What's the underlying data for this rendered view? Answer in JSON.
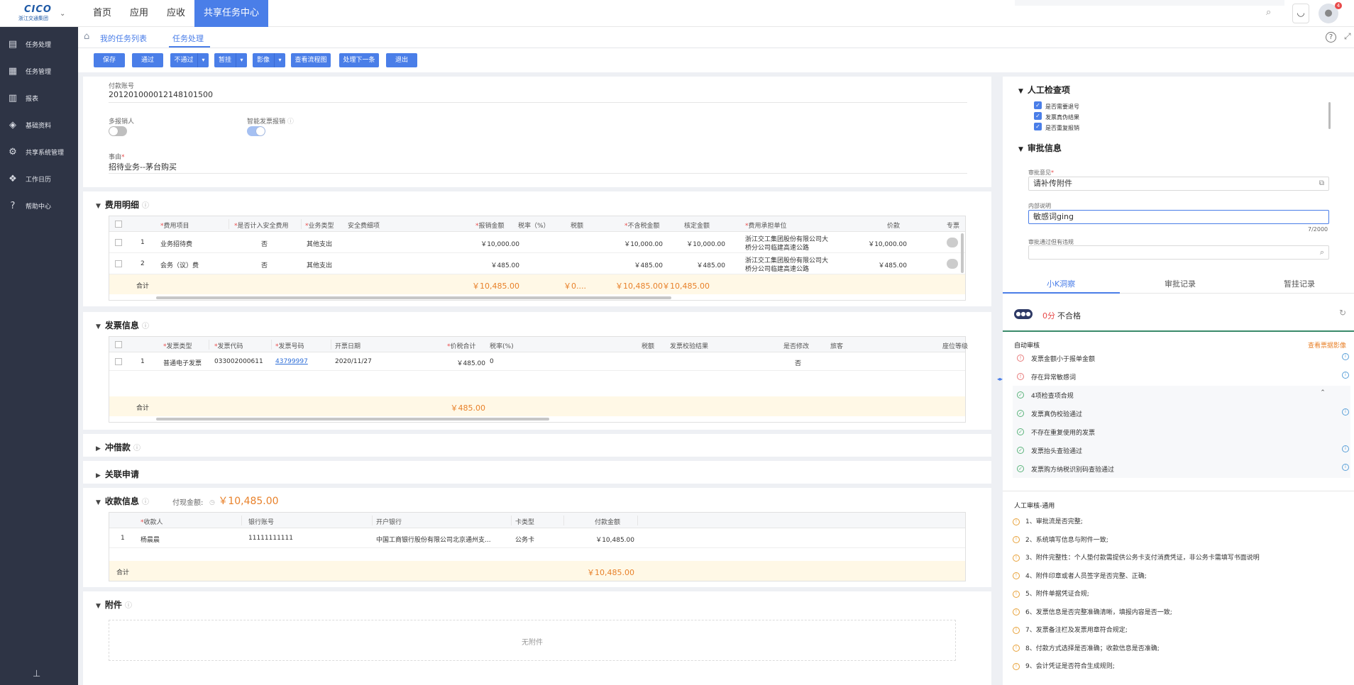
{
  "header": {
    "logo_main": "CICO",
    "logo_sub": "浙江交通集团",
    "nav": [
      "首页",
      "应用",
      "应收",
      "共享任务中心"
    ]
  },
  "sidebar": {
    "items": [
      {
        "label": "任务处理",
        "icon": "task-icon"
      },
      {
        "label": "任务管理",
        "icon": "task-manage-icon"
      },
      {
        "label": "报表",
        "icon": "report-icon"
      },
      {
        "label": "基础资料",
        "icon": "layers-icon"
      },
      {
        "label": "共享系统管理",
        "icon": "settings-icon"
      },
      {
        "label": "工作日历",
        "icon": "calendar-icon"
      },
      {
        "label": "帮助中心",
        "icon": "help-icon"
      }
    ]
  },
  "breadcrumb": {
    "items": [
      "我的任务列表",
      "任务处理"
    ]
  },
  "toolbar": {
    "buttons": [
      "保存",
      "通过",
      "不通过",
      "暂挂",
      "影像",
      "查看流程图",
      "处理下一条",
      "退出"
    ]
  },
  "basic": {
    "payee_account_label": "付款账号",
    "payee_account": "201201000012148101500",
    "multi_reimburser_label": "多报销人",
    "smart_invoice_label": "智能发票报销",
    "reason_label": "事由",
    "reason": "招待业务--茅台购买"
  },
  "expense": {
    "title": "费用明细",
    "headers": [
      "费用项目",
      "是否计入安全费用",
      "业务类型",
      "安全费细项",
      "报销金额",
      "税率（%）",
      "税额",
      "不含税金额",
      "核定金额",
      "费用承担单位",
      "价款",
      "专票"
    ],
    "rows": [
      {
        "no": "1",
        "item": "业务招待费",
        "safety": "否",
        "type": "其他支出",
        "amount": "￥10,000.00",
        "ex_tax": "￥10,000.00",
        "approved": "￥10,000.00",
        "unit_l1": "浙江交工集团股份有限公司大",
        "unit_l2": "桥分公司临建高速公路",
        "price": "￥10,000.00"
      },
      {
        "no": "2",
        "item": "会务（议）费",
        "safety": "否",
        "type": "其他支出",
        "amount": "￥485.00",
        "ex_tax": "￥485.00",
        "approved": "￥485.00",
        "unit_l1": "浙江交工集团股份有限公司大",
        "unit_l2": "桥分公司临建高速公路",
        "price": "￥485.00"
      }
    ],
    "total_label": "合计",
    "total_amount": "￥10,485.00",
    "total_tax": "￥0....",
    "total_ex_tax": "￥10,485.00",
    "total_approved": "￥10,485.00"
  },
  "invoice": {
    "title": "发票信息",
    "headers": [
      "发票类型",
      "发票代码",
      "发票号码",
      "开票日期",
      "价税合计",
      "税率(%)",
      "税额",
      "发票校验结果",
      "是否修改",
      "旅客",
      "座位等级"
    ],
    "rows": [
      {
        "no": "1",
        "type": "普通电子发票",
        "code": "033002000611",
        "number": "43799997",
        "date": "2020/11/27",
        "total": "￥485.00",
        "rate": "0",
        "modified": "否"
      }
    ],
    "total_label": "合计",
    "total": "￥485.00"
  },
  "offset": {
    "title": "冲借款"
  },
  "related": {
    "title": "关联申请"
  },
  "receipt": {
    "title": "收款信息",
    "pay_label": "付现金额:",
    "pay_amount": "￥10,485.00",
    "headers": [
      "收款人",
      "银行账号",
      "开户银行",
      "卡类型",
      "付款金额"
    ],
    "rows": [
      {
        "no": "1",
        "payee": "杨晨晨",
        "account": "11111111111",
        "bank": "中国工商银行股份有限公司北京通州支...",
        "card": "公务卡",
        "amount": "￥10,485.00"
      }
    ],
    "total_label": "合计",
    "total": "￥10,485.00"
  },
  "attachment": {
    "title": "附件",
    "empty": "无附件"
  },
  "right": {
    "manual_check_title": "人工检查项",
    "manual_checks": [
      "是否需要退号",
      "发票真伪结果",
      "是否重复报销"
    ],
    "approval_title": "审批信息",
    "opinion_label": "审批意见",
    "opinion": "请补传附件",
    "internal_label": "内部说明",
    "internal": "敏感词ging",
    "internal_count": "7/2000",
    "pass_label": "审批通过但有违规",
    "tabs": [
      "小K洞察",
      "审批记录",
      "暂挂记录"
    ],
    "score": "0分",
    "score_text": "不合格",
    "auto_title": "自动审核",
    "auto_link": "查看票据影像",
    "auto_items": [
      {
        "text": "发票金额小于报单金额",
        "status": "error"
      },
      {
        "text": "存在异常敏感词",
        "status": "error"
      },
      {
        "text": "4项检查项合规",
        "status": "ok"
      },
      {
        "text": "发票真伪校验通过",
        "status": "ok"
      },
      {
        "text": "不存在重复使用的发票",
        "status": "ok"
      },
      {
        "text": "发票抬头查验通过",
        "status": "ok"
      },
      {
        "text": "发票购方纳税识别码查验通过",
        "status": "ok"
      }
    ],
    "manual_title": "人工审核-通用",
    "manual_items": [
      "1、审批流是否完整;",
      "2、系统填写信息与附件一致;",
      "3、附件完整性：个人垫付款需提供公务卡支付消费凭证，非公务卡需填写书面说明",
      "4、附件印章或者人员签字是否完整、正确;",
      "5、附件单据凭证合规;",
      "6、发票信息是否完整准确清晰，填报内容是否一致;",
      "7、发票备注栏及发票用章符合规定;",
      "8、付款方式选择是否准确；收款信息是否准确;",
      "9、会计凭证是否符合生成规则;"
    ]
  }
}
